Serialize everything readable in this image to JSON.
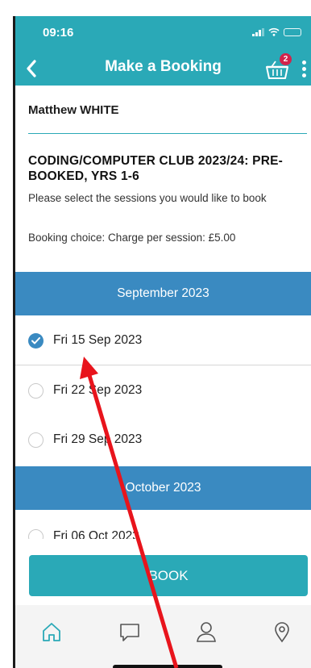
{
  "status_bar": {
    "time": "09:16"
  },
  "app_bar": {
    "title": "Make a Booking",
    "basket_count": "2"
  },
  "user": {
    "name": "Matthew WHITE"
  },
  "club": {
    "title": "CODING/COMPUTER CLUB 2023/24: PRE-BOOKED, YRS 1-6",
    "instructions": "Please select the sessions you would like to book",
    "booking_choice": "Booking choice: Charge per session: £5.00"
  },
  "months": [
    {
      "label": "September 2023",
      "sessions": [
        {
          "label": "Fri 15 Sep 2023",
          "checked": true
        },
        {
          "label": "Fri 22 Sep 2023",
          "checked": false
        },
        {
          "label": "Fri 29 Sep 2023",
          "checked": false
        }
      ]
    },
    {
      "label": "October 2023",
      "sessions": [
        {
          "label": "Fri 06 Oct 2023",
          "checked": false
        }
      ]
    }
  ],
  "book_button": {
    "label": "BOOK"
  },
  "tabs": [
    {
      "icon": "home-icon"
    },
    {
      "icon": "chat-icon"
    },
    {
      "icon": "user-icon"
    },
    {
      "icon": "location-pin-icon"
    }
  ],
  "colors": {
    "primary": "#2aa9b7",
    "month_header": "#3a8ac1",
    "badge": "#d2234b",
    "annotation": "#e8141c"
  }
}
